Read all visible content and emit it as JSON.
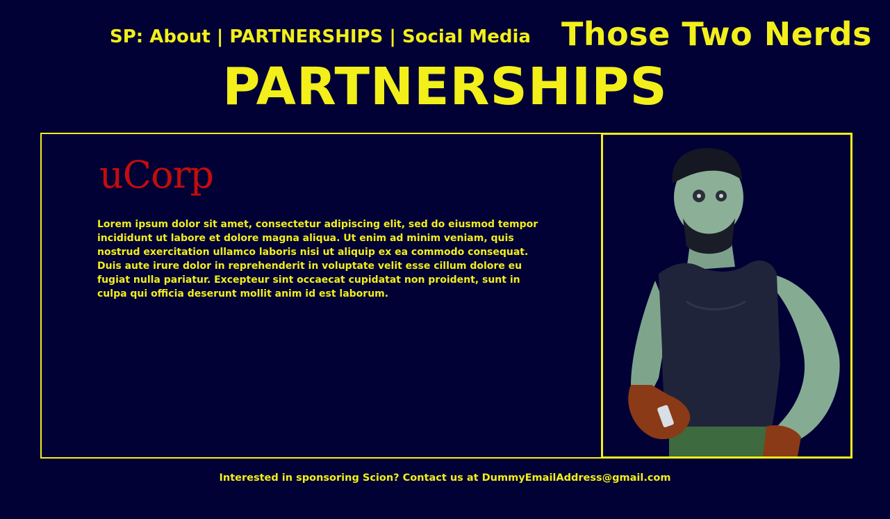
{
  "nav": {
    "prefix": "SP:",
    "items": [
      "About",
      "PARTNERSHIPS",
      "Social Media"
    ],
    "separator": "|"
  },
  "brand": "Those Two Nerds",
  "page_title": "PARTNERSHIPS",
  "partner": {
    "name": "uCorp",
    "description": "Lorem ipsum dolor sit amet, consectetur adipiscing elit, sed do eiusmod tempor incididunt ut labore et dolore magna aliqua. Ut enim ad minim veniam, quis nostrud exercitation ullamco laboris nisi ut aliquip ex ea commodo consequat. Duis aute irure dolor in reprehenderit in voluptate velit esse cillum dolore eu fugiat nulla pariatur. Excepteur sint occaecat cupidatat non proident, sunt in culpa qui officia deserunt mollit anim id est laborum."
  },
  "footer": {
    "text": "Interested in sponsoring Scion? Contact us at ",
    "email": "DummyEmailAddress@gmail.com"
  },
  "colors": {
    "background": "#010135",
    "accent": "#f2ef1a",
    "logo": "#c40d0d"
  }
}
